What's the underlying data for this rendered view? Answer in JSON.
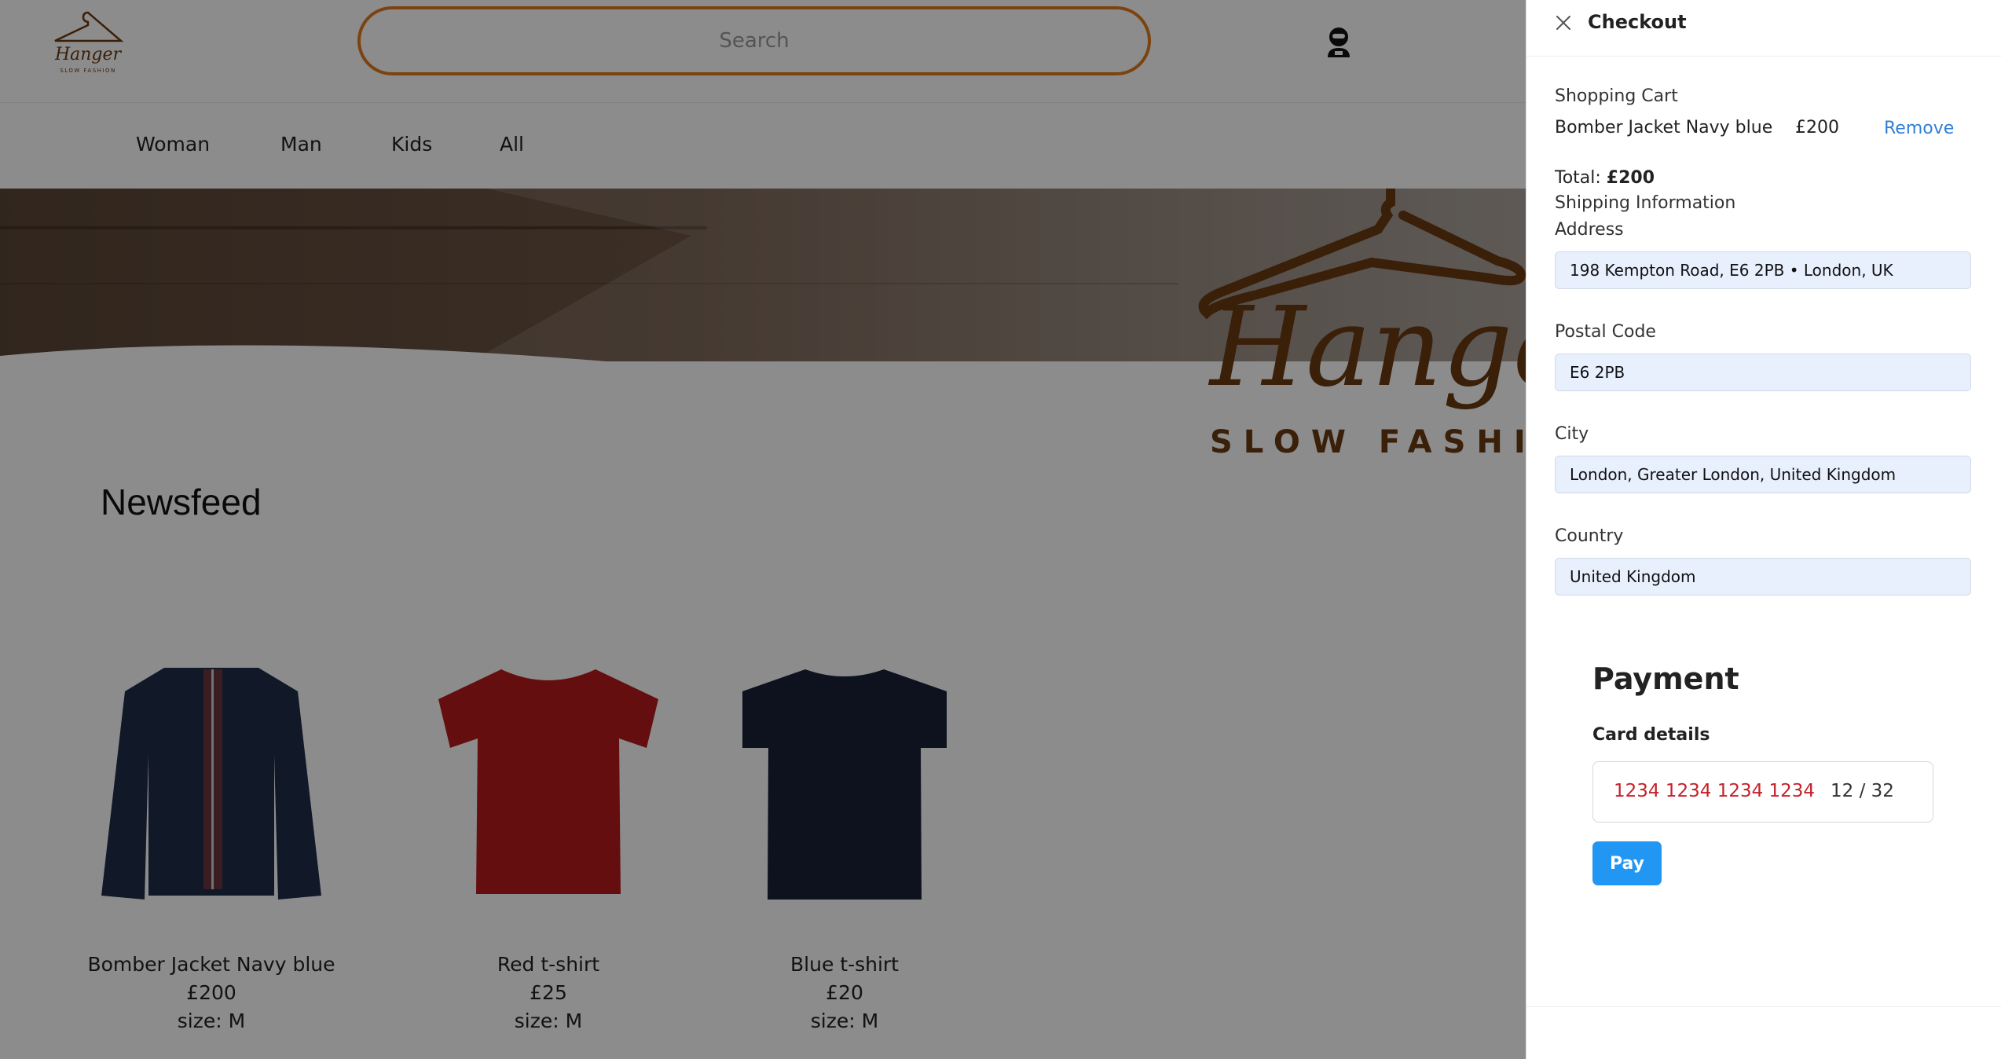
{
  "header": {
    "brand_script": "Hanger",
    "brand_tag": "SLOW FASHION",
    "search_placeholder": "Search"
  },
  "nav": {
    "items": [
      {
        "label": "Woman"
      },
      {
        "label": "Man"
      },
      {
        "label": "Kids"
      },
      {
        "label": "All"
      }
    ]
  },
  "hero": {
    "brand_script": "Hanger",
    "brand_tag": "SLOW FASHIO"
  },
  "main": {
    "newsfeed_title": "Newsfeed",
    "products": [
      {
        "name": "Bomber Jacket Navy blue",
        "price": "£200",
        "size": "size: M"
      },
      {
        "name": "Red t-shirt",
        "price": "£25",
        "size": "size: M"
      },
      {
        "name": "Blue t-shirt",
        "price": "£20",
        "size": "size: M"
      }
    ]
  },
  "checkout": {
    "title": "Checkout",
    "cart_label": "Shopping Cart",
    "cart_item": {
      "name": "Bomber Jacket Navy blue",
      "price": "£200",
      "remove_label": "Remove"
    },
    "total_label": "Total:",
    "total_value": "£200",
    "shipping_label": "Shipping Information",
    "fields": {
      "address_label": "Address",
      "address_value": "198 Kempton Road, E6 2PB • London, UK",
      "postal_label": "Postal Code",
      "postal_value": "E6 2PB",
      "city_label": "City",
      "city_value": "London, Greater London, United Kingdom",
      "country_label": "Country",
      "country_value": "United Kingdom"
    },
    "payment": {
      "title": "Payment",
      "card_label": "Card details",
      "card_number": "1234 1234 1234 1234",
      "card_expiry": "12 / 32",
      "pay_label": "Pay"
    }
  },
  "colors": {
    "accent_orange": "#e07a1c",
    "brand_brown": "#6b3a12",
    "pay_blue": "#2196f3",
    "link_blue": "#2f7fd6",
    "card_number_red": "#c3222a",
    "field_bg": "#e8f0fe"
  },
  "icons": [
    "hanger-logo-icon",
    "user-icon",
    "close-icon"
  ]
}
